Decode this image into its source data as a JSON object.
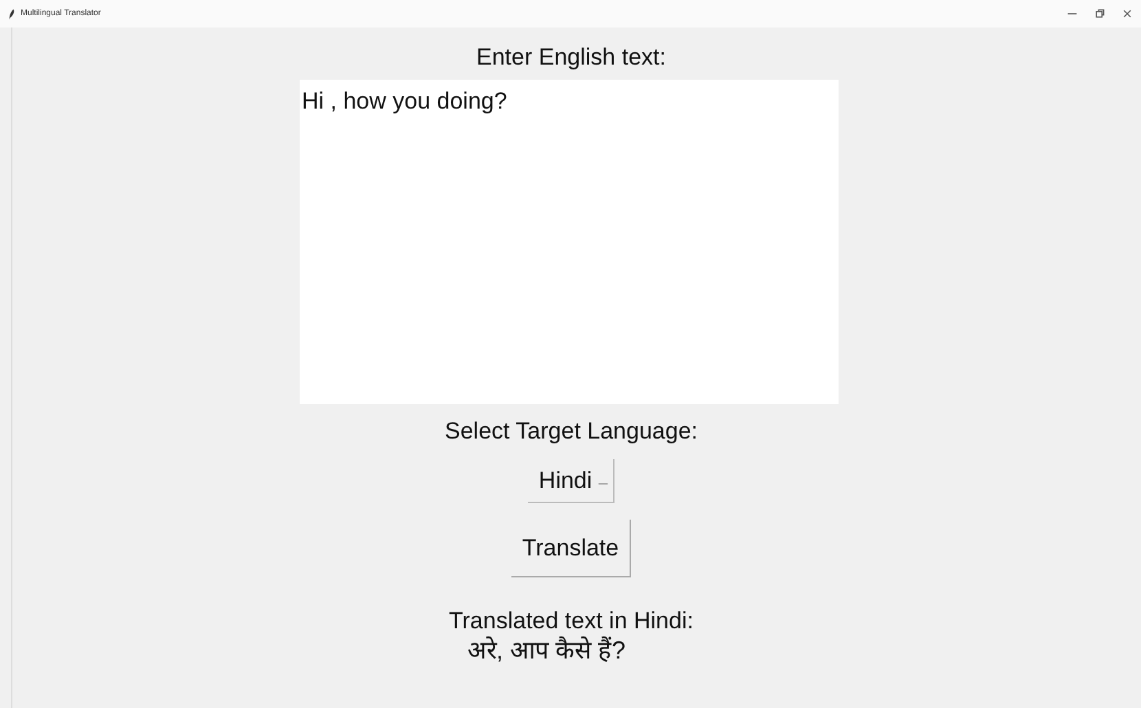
{
  "window": {
    "title": "Multilingual Translator"
  },
  "input_label": "Enter English text:",
  "input": {
    "value": "Hi , how you doing?"
  },
  "language_label": "Select Target Language:",
  "language_dropdown": {
    "value": "Hindi",
    "caret": "–"
  },
  "translate_button": "Translate",
  "result_label": "Translated text in Hindi:",
  "result_text": "अरे, आप कैसे हैं?"
}
